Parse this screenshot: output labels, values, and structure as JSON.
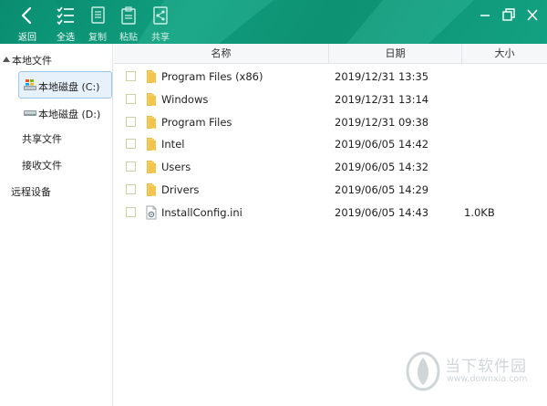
{
  "toolbar": {
    "buttons": [
      {
        "label": "返回",
        "icon": "back-arrow-icon"
      },
      {
        "label": "全选",
        "icon": "select-all-icon"
      },
      {
        "label": "复制",
        "icon": "copy-icon"
      },
      {
        "label": "粘贴",
        "icon": "paste-icon"
      },
      {
        "label": "共享",
        "icon": "share-icon"
      }
    ],
    "window_controls": [
      "minimize-icon",
      "restore-icon",
      "close-icon"
    ],
    "colors": {
      "bar": "#11a583",
      "text": "#ffffff"
    }
  },
  "sidebar": {
    "local_section": "本地文件",
    "drive_c": "本地磁盘 (C:)",
    "drive_d": "本地磁盘 (D:)",
    "shared": "共享文件",
    "received": "接收文件",
    "remote": "远程设备"
  },
  "list": {
    "headers": {
      "name": "名称",
      "date": "日期",
      "size": "大小"
    },
    "rows": [
      {
        "name": "Program Files (x86)",
        "date": "2019/12/31 13:35",
        "size": "",
        "type": "folder"
      },
      {
        "name": "Windows",
        "date": "2019/12/31 13:14",
        "size": "",
        "type": "folder"
      },
      {
        "name": "Program Files",
        "date": "2019/12/31 09:38",
        "size": "",
        "type": "folder"
      },
      {
        "name": "Intel",
        "date": "2019/06/05 14:42",
        "size": "",
        "type": "folder"
      },
      {
        "name": "Users",
        "date": "2019/06/05 14:32",
        "size": "",
        "type": "folder"
      },
      {
        "name": "Drivers",
        "date": "2019/06/05 14:29",
        "size": "",
        "type": "folder"
      },
      {
        "name": "InstallConfig.ini",
        "date": "2019/06/05 14:43",
        "size": "1.0KB",
        "type": "file"
      }
    ]
  },
  "watermark": {
    "title": "当下软件园",
    "url": "www.downxia.com"
  }
}
